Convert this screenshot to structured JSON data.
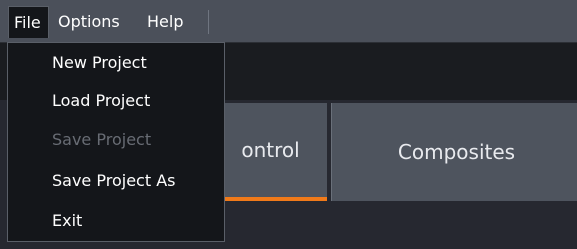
{
  "menubar": {
    "items": [
      {
        "label": "File"
      },
      {
        "label": "Options"
      },
      {
        "label": "Help"
      }
    ]
  },
  "file_menu": {
    "items": [
      {
        "label": "New Project",
        "enabled": true
      },
      {
        "label": "Load Project",
        "enabled": true
      },
      {
        "label": "Save Project",
        "enabled": false
      },
      {
        "label": "Save Project As",
        "enabled": true
      },
      {
        "label": "Exit",
        "enabled": true
      }
    ]
  },
  "tabs": [
    {
      "label": "ontrol",
      "selected": true
    },
    {
      "label": "Composites",
      "selected": false
    }
  ],
  "colors": {
    "accent": "#f07a1a",
    "menubar": "#4b505a",
    "menu_bg": "#14161a",
    "disabled_text": "#686c74"
  }
}
